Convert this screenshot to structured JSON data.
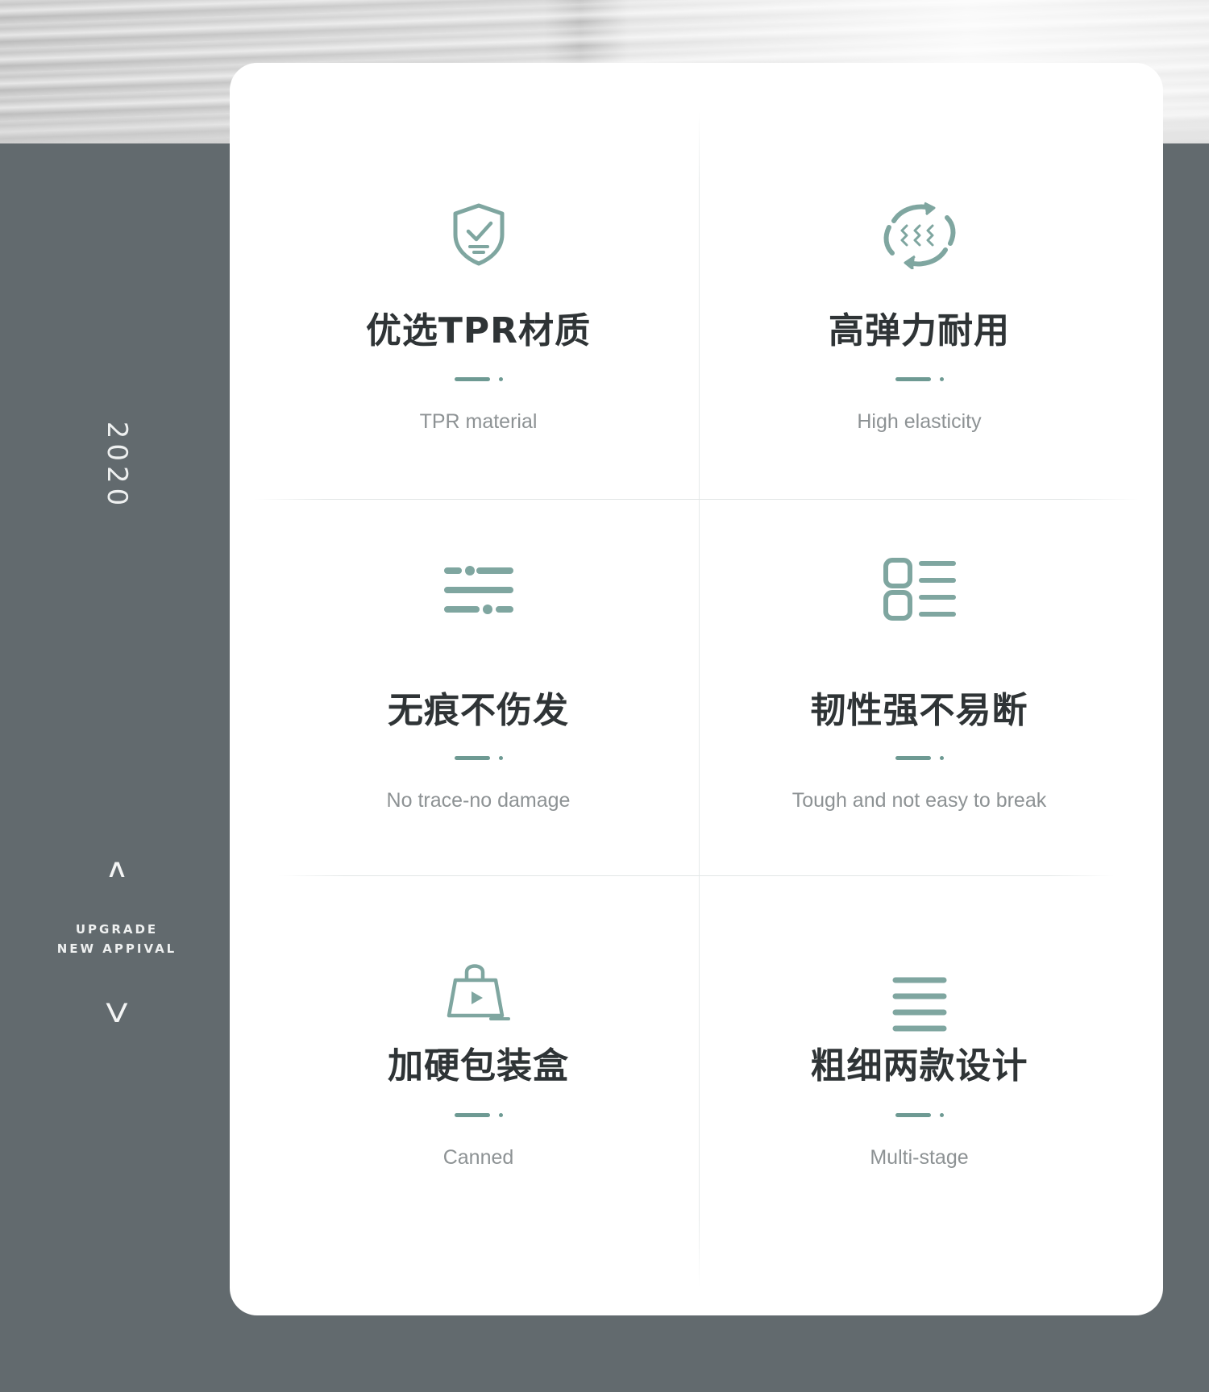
{
  "side": {
    "year": "2020",
    "up_arrow": "∧",
    "label_line1": "UPGRADE",
    "label_line2": "NEW APPIVAL",
    "down_arrow": "V"
  },
  "colors": {
    "background": "#626a6e",
    "card": "#ffffff",
    "accent": "#6e9a93",
    "title": "#2f3436",
    "subtitle": "#8d9294"
  },
  "features": [
    {
      "icon": "shield-check-icon",
      "title": "优选TPR材质",
      "subtitle": "TPR material"
    },
    {
      "icon": "elastic-cycle-icon",
      "title": "高弹力耐用",
      "subtitle": "High elasticity"
    },
    {
      "icon": "sliders-icon",
      "title": "无痕不伤发",
      "subtitle": "No trace-no damage"
    },
    {
      "icon": "list-blocks-icon",
      "title": "韧性强不易断",
      "subtitle": "Tough and not easy to break"
    },
    {
      "icon": "shopping-bag-icon",
      "title": "加硬包装盒",
      "subtitle": "Canned"
    },
    {
      "icon": "lines-icon",
      "title": "粗细两款设计",
      "subtitle": "Multi-stage"
    }
  ]
}
